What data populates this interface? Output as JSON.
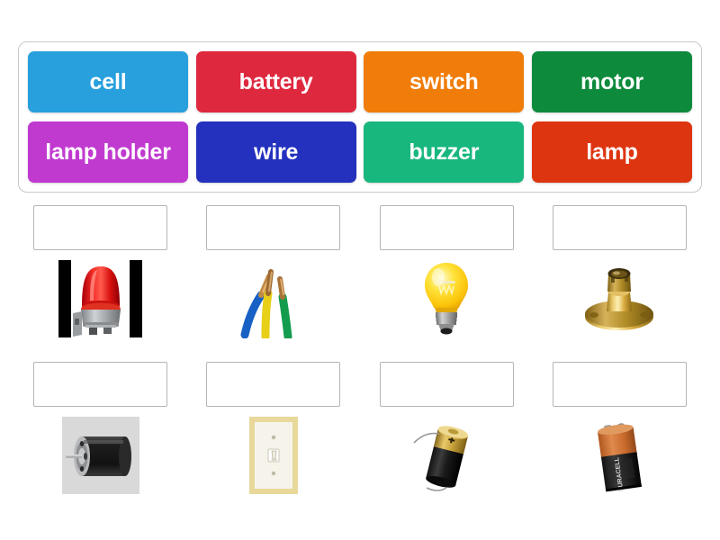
{
  "activity": {
    "type": "drag-and-drop-labelling",
    "topic": "electrical circuit components"
  },
  "wordbank": {
    "rows": [
      [
        {
          "label": "cell",
          "color": "#27a0dd"
        },
        {
          "label": "battery",
          "color": "#de283e"
        },
        {
          "label": "switch",
          "color": "#f07d0a"
        },
        {
          "label": "motor",
          "color": "#0e8a3c"
        }
      ],
      [
        {
          "label": "lamp holder",
          "color": "#c13ad0"
        },
        {
          "label": "wire",
          "color": "#2331be"
        },
        {
          "label": "buzzer",
          "color": "#18b77e"
        },
        {
          "label": "lamp",
          "color": "#de3511"
        }
      ]
    ]
  },
  "grid": {
    "rows": [
      [
        {
          "answer_value": "",
          "image": "buzzer-siren-image",
          "image_alt": "red siren buzzer"
        },
        {
          "answer_value": "",
          "image": "wires-image",
          "image_alt": "three stripped copper wires"
        },
        {
          "answer_value": "",
          "image": "lamp-bulb-image",
          "image_alt": "glowing yellow light bulb"
        },
        {
          "answer_value": "",
          "image": "lamp-holder-image",
          "image_alt": "brass bayonet lamp holder"
        }
      ],
      [
        {
          "answer_value": "",
          "image": "motor-image",
          "image_alt": "black dc electric motor"
        },
        {
          "answer_value": "",
          "image": "switch-image",
          "image_alt": "toggle light switch on wall plate"
        },
        {
          "answer_value": "",
          "image": "cell-image",
          "image_alt": "single cell battery with wires"
        },
        {
          "answer_value": "",
          "image": "battery-9v-image",
          "image_alt": "nine volt battery"
        }
      ]
    ]
  }
}
